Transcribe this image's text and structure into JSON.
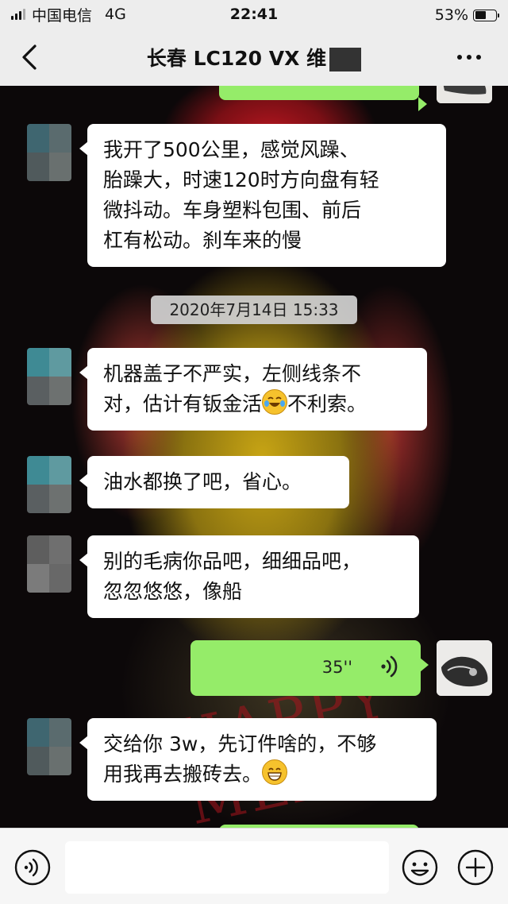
{
  "status_bar": {
    "carrier": "中国电信",
    "network": "4G",
    "time": "22:41",
    "battery_text": "53%",
    "battery_level": 0.53
  },
  "nav": {
    "title": "长春 LC120 VX 维"
  },
  "timestamp": "2020年7月14日 15:33",
  "messages": [
    {
      "side": "left",
      "text": "我开了500公里，感觉风躁、\n胎躁大，时速120时方向盘有轻\n微抖动。车身塑料包围、前后\n杠有松动。刹车来的慢"
    },
    {
      "side": "left",
      "text_before": "机器盖子不严实，左侧线条不\n对，估计有钣金活",
      "emoji": "crying-laughing-face",
      "text_after": "不利索。"
    },
    {
      "side": "left",
      "text": "油水都换了吧，省心。"
    },
    {
      "side": "left",
      "text": "别的毛病你品吧，细细品吧，\n忽忽悠悠，像船"
    },
    {
      "side": "right",
      "type": "voice",
      "duration": "35''"
    },
    {
      "side": "left",
      "text_before": "交给你 3w，先订件啥的，不够\n用我再去搬砖去。",
      "emoji": "grinning-face"
    }
  ],
  "colors": {
    "bubble_left": "#ffffff",
    "bubble_right": "#95ec69",
    "bar_bg": "#ededed"
  },
  "icons": {
    "back": "chevron-left-icon",
    "more": "more-dots-icon",
    "voice_toggle": "voice-wave-icon",
    "emoji": "smiley-icon",
    "plus": "plus-icon"
  }
}
